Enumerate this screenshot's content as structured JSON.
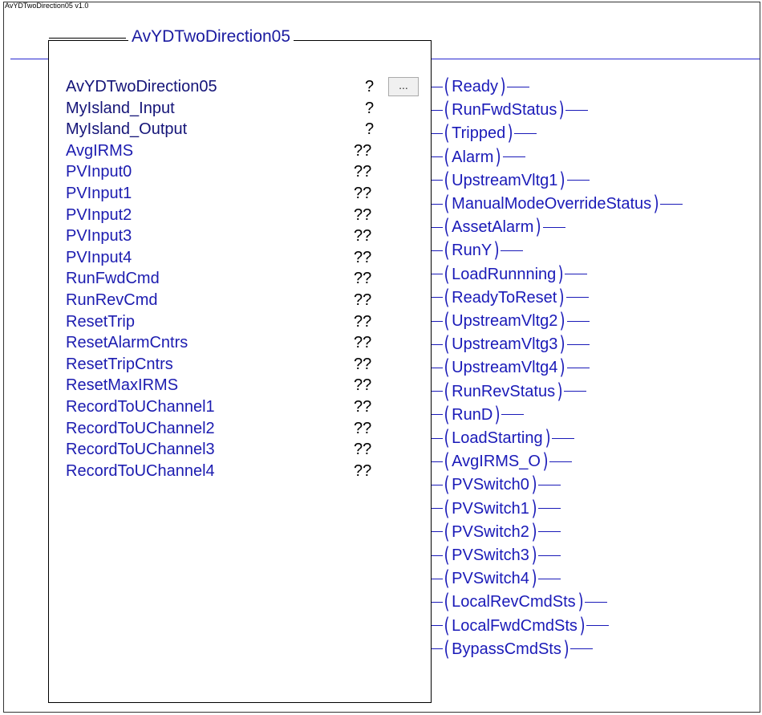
{
  "version_label": "AvYDTwoDirection05 v1.0",
  "block": {
    "title": "AvYDTwoDirection05",
    "browse_label": "..."
  },
  "inputs": [
    {
      "name": "AvYDTwoDirection05",
      "value": "?"
    },
    {
      "name": "MyIsland_Input",
      "value": "?"
    },
    {
      "name": "MyIsland_Output",
      "value": "?"
    },
    {
      "name": "AvgIRMS",
      "value": "??"
    },
    {
      "name": "PVInput0",
      "value": "??"
    },
    {
      "name": "PVInput1",
      "value": "??"
    },
    {
      "name": "PVInput2",
      "value": "??"
    },
    {
      "name": "PVInput3",
      "value": "??"
    },
    {
      "name": "PVInput4",
      "value": "??"
    },
    {
      "name": "RunFwdCmd",
      "value": "??"
    },
    {
      "name": "RunRevCmd",
      "value": "??"
    },
    {
      "name": "ResetTrip",
      "value": "??"
    },
    {
      "name": "ResetAlarmCntrs",
      "value": "??"
    },
    {
      "name": "ResetTripCntrs",
      "value": "??"
    },
    {
      "name": "ResetMaxIRMS",
      "value": "??"
    },
    {
      "name": "RecordToUChannel1",
      "value": "??"
    },
    {
      "name": "RecordToUChannel2",
      "value": "??"
    },
    {
      "name": "RecordToUChannel3",
      "value": "??"
    },
    {
      "name": "RecordToUChannel4",
      "value": "??"
    }
  ],
  "outputs": [
    "Ready",
    "RunFwdStatus",
    "Tripped",
    "Alarm",
    "UpstreamVltg1",
    "ManualModeOverrideStatus",
    "AssetAlarm",
    "RunY",
    "LoadRunnning",
    "ReadyToReset",
    "UpstreamVltg2",
    "UpstreamVltg3",
    "UpstreamVltg4",
    "RunRevStatus",
    "RunD",
    "LoadStarting",
    "AvgIRMS_O",
    "PVSwitch0",
    "PVSwitch1",
    "PVSwitch2",
    "PVSwitch3",
    "PVSwitch4",
    "LocalRevCmdSts",
    "LocalFwdCmdSts",
    "BypassCmdSts"
  ]
}
